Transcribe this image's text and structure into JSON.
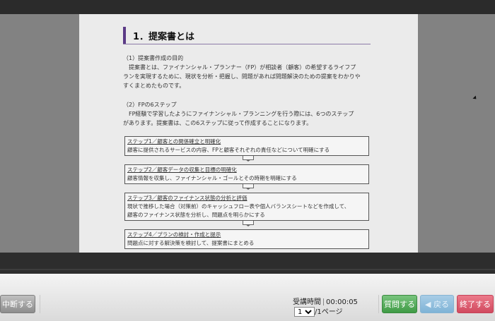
{
  "document": {
    "heading": "1．提案書とは",
    "section1": {
      "title": "（1）提案書作成の目的",
      "lines": [
        "提案書とは、ファイナンシャル・プランナー（FP）が相談者（顧客）の希望するライフプ",
        "ランを実現するために、現状を分析・把握し、問題があれば問題解決のための提案をわかりや",
        "すくまとめたものです。"
      ]
    },
    "section2": {
      "title": "（2）FPの6ステップ",
      "lines": [
        "FP経験で学習したようにファイナンシャル・プランニングを行う際には、6つのステップ",
        "があります。提案書は、この6ステップに従って作成することになります。"
      ]
    },
    "steps": [
      {
        "title": "ステップ1／顧客との関係確立と明確化",
        "desc": "顧客に提供されるサービスの内容、FPと顧客それぞれの責任などについて明確にする"
      },
      {
        "title": "ステップ2／顧客データの収集と目標の明確化",
        "desc": "顧客情報を収集し、ファイナンシャル・ゴールとその時期を明確にする"
      },
      {
        "title": "ステップ3／顧客のファイナンス状態の分析と評価",
        "desc": "現状で推移した場合（対策前）のキャッシュフロー表や個人バランスシートなどを作成して、",
        "desc2": "顧客のファイナンス状態を分析し、問題点を明らかにする"
      },
      {
        "title": "ステップ4／プランの検討・作成と提示",
        "desc": "問題点に対する解決策を検討して、提案書にまとめる"
      }
    ]
  },
  "controls": {
    "stop_label": "中断する",
    "time_label": "受講時間",
    "time_value": "00:00:05",
    "page_current": "1",
    "page_total_suffix": "/1ページ",
    "question_label": "質問する",
    "back_label": "◀ 戻る",
    "end_label": "終了する"
  }
}
